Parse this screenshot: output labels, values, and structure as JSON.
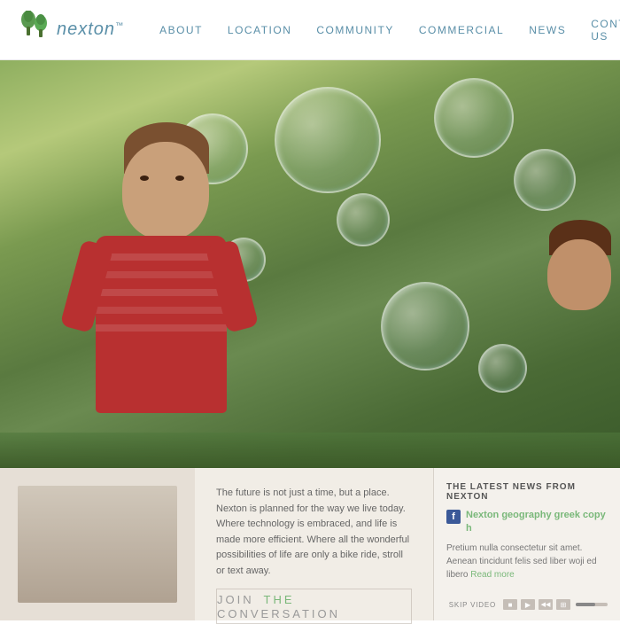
{
  "header": {
    "logo_text": "nexton",
    "logo_tm": "™",
    "nav_items": [
      {
        "label": "ABOUT",
        "id": "about"
      },
      {
        "label": "LOCATION",
        "id": "location"
      },
      {
        "label": "COMMUNITY",
        "id": "community"
      },
      {
        "label": "COMMERCIAL",
        "id": "commercial"
      },
      {
        "label": "NEWS",
        "id": "news"
      },
      {
        "label": "CONTACT US",
        "id": "contact"
      }
    ]
  },
  "lower": {
    "description": "The future is not just a time, but a place. Nexton is planned for the way we live today. Where technology is embraced, and life is made more efficient. Where all the wonderful possibilities of life are only a bike ride, stroll or text away.",
    "join_label": "JOIN",
    "the_label": "THE",
    "conversation_label": "CONVERSATION"
  },
  "news": {
    "title": "THE LATEST NEWS FROM NEXTON",
    "headline": "Nexton geography greek copy h",
    "body": "Pretium nulla consectetur sit amet. Aenean tincidunt felis sed liber woji ed libero",
    "read_more": "Read more"
  },
  "video_controls": {
    "skip_label": "SKIP VIDEO",
    "play_icon": "▶",
    "stop_icon": "■",
    "mute_icon": "◀◀",
    "expand_icon": "⊞"
  }
}
